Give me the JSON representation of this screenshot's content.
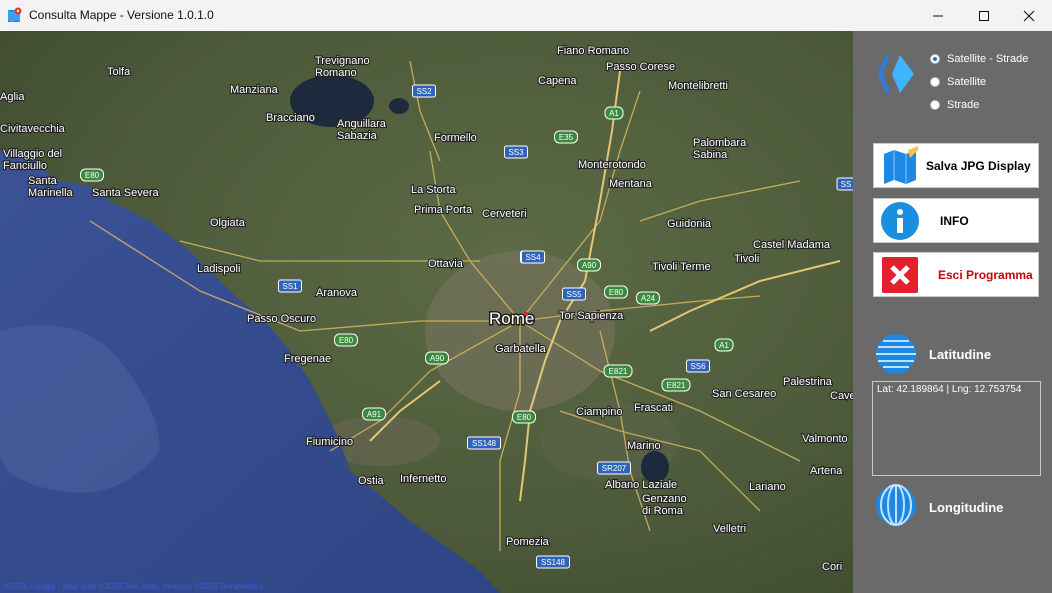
{
  "window": {
    "title": "Consulta Mappe - Versione 1.0.1.0"
  },
  "map": {
    "center_label": "Rome",
    "places": [
      "Fiano Romano",
      "Trevignano Romano",
      "Passo Corese",
      "Tolfa",
      "Capena",
      "Montelibretti",
      "Manziana",
      "Bracciano",
      "Anguillara Sabazia",
      "Formello",
      "Civitavecchia",
      "Monterotondo",
      "Palombara Sabina",
      "Villaggio del Fanciullo",
      "Mentana",
      "Santa Marinella",
      "Santa Severa",
      "Olgiata",
      "La Storta",
      "Prima Porta",
      "Cerveteri",
      "Guidonia",
      "Castel Madama",
      "Ladispoli",
      "Ottavia",
      "Tivoli Terme",
      "Tivoli",
      "Aranova",
      "Passo Oscuro",
      "Tor Sapienza",
      "Fregenae",
      "Garbatella",
      "Palestrina",
      "Fiumicino",
      "Ciampino",
      "Frascati",
      "San Cesareo",
      "Marino",
      "Valmonto",
      "Ostia",
      "Infernetto",
      "Albano Laziale",
      "Genzano di Roma",
      "Lariano",
      "Artena",
      "Velletri",
      "Pomezia",
      "Cori",
      "Cave",
      "Aglia"
    ],
    "roads": [
      "SS2",
      "SS4",
      "E35",
      "SS3",
      "A1",
      "E80",
      "SS1",
      "SS4",
      "A90",
      "SS5",
      "E80",
      "A24",
      "E80",
      "A90",
      "E821",
      "E821",
      "SS6",
      "A1",
      "A91",
      "E80",
      "SS148",
      "SR207",
      "SS148",
      "SS"
    ],
    "attribution": "©2026 Google - Map data ©2026 Tele Atlas, Imagery ©2026 TerraMetrics"
  },
  "panel": {
    "radio_options": [
      {
        "label": "Satellite - Strade",
        "selected": true
      },
      {
        "label": "Satellite",
        "selected": false
      },
      {
        "label": "Strade",
        "selected": false
      }
    ],
    "save_button": "Salva JPG Display",
    "info_button": "INFO",
    "exit_button": "Esci  Programma",
    "latitude_label": "Latitudine",
    "longitude_label": "Longitudine",
    "coords_text": "Lat: 42.189864 | Lng: 12.753754"
  },
  "colors": {
    "panel_bg": "#6a6a6a",
    "exit_text": "#c8000a",
    "accent_blue": "#1a8fe0"
  }
}
